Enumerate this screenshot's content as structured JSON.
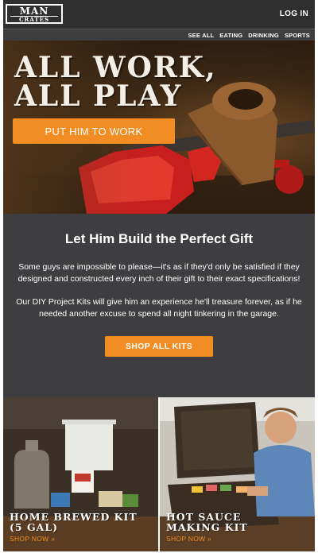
{
  "header": {
    "logo_line1": "MAN",
    "logo_line2": "CRATES",
    "login_label": "LOG IN"
  },
  "nav": {
    "items": [
      "SEE ALL",
      "EATING",
      "DRINKING",
      "SPORTS"
    ]
  },
  "hero": {
    "title_line1": "ALL WORK,",
    "title_line2": "ALL PLAY",
    "cta_label": "PUT HIM TO WORK"
  },
  "info": {
    "heading": "Let Him Build the Perfect Gift",
    "paragraph1": "Some guys are impossible to please—it's as if they'd only be satisfied if they designed and constructed every inch of their gift to their exact specifications!",
    "paragraph2": "Our DIY Project Kits will give him an experience he'll treasure forever, as if he needed another excuse to spend all night tinkering in the garage.",
    "cta_label": "SHOP ALL KITS"
  },
  "products": [
    {
      "line1": "HOME BREWED KIT",
      "line2": "(5 GAL)",
      "link": "SHOP NOW »"
    },
    {
      "line1": "HOT SAUCE",
      "line2": "MAKING KIT",
      "link": "SHOP NOW »"
    }
  ],
  "colors": {
    "accent": "#f18d22",
    "header_bg": "#2f2f2f",
    "info_bg": "#3e3e40"
  }
}
